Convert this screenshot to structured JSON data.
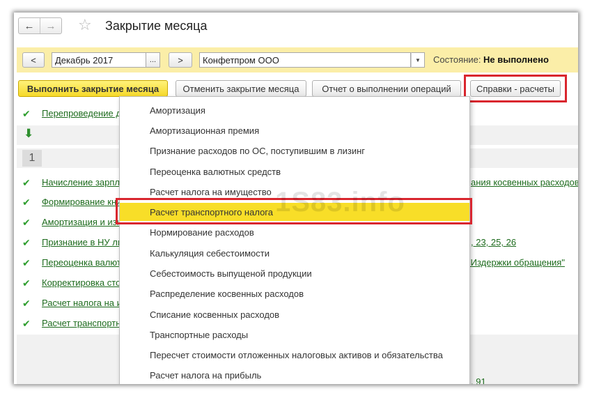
{
  "window": {
    "title": "Закрытие месяца"
  },
  "filter": {
    "prev_label": "<",
    "period": "Декабрь 2017",
    "dots_label": "...",
    "next_label": ">",
    "organization": "Конфетпром ООО",
    "state_label": "Состояние:",
    "state_value": "Не выполнено"
  },
  "actions": {
    "run_label": "Выполнить закрытие месяца",
    "cancel_label": "Отменить закрытие месяца",
    "report_label": "Отчет о выполнении операций",
    "references_label": "Справки - расчеты"
  },
  "tasks": {
    "items": [
      "Перепроведение д",
      "Начисление зарпла",
      "Формирование кни",
      "Амортизация и изн",
      "Признание в НУ ли",
      "Переоценка валют",
      "Корректировка стои",
      "Расчет налога на и",
      "Расчет транспортн"
    ],
    "group_number": "1",
    "right_links": [
      "ания косвенных расходов",
      ", 23, 25, 26",
      "\"Издержки обращения\"",
      ", 91"
    ]
  },
  "menu": {
    "items": [
      "Амортизация",
      "Амортизационная премия",
      "Признание расходов по ОС, поступившим в лизинг",
      "Переоценка валютных средств",
      "Расчет налога на имущество",
      "Расчет транспортного налога",
      "Нормирование расходов",
      "Калькуляция себестоимости",
      "Себестоимость выпущеной продукции",
      "Распределение косвенных расходов",
      "Списание косвенных расходов",
      "Транспортные расходы",
      "Пересчет стоимости отложенных налоговых активов и обязательства",
      "Расчет налога на прибыль"
    ],
    "selected_index": 5
  },
  "watermark": "1S83.info",
  "colors": {
    "accent_yellow": "#f8de28",
    "highlight_red": "#d9262e",
    "link_green": "#1d6b1d",
    "check_green": "#2f9e2f"
  }
}
